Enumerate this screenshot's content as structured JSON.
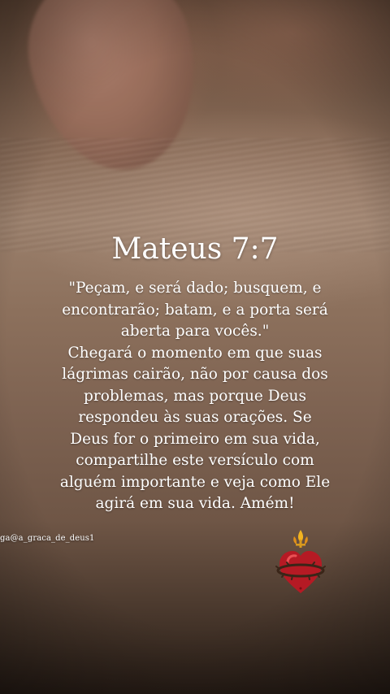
{
  "post": {
    "title": "Mateus 7:7",
    "quote": "\"Peçam, e será dado; busquem, e encontrarão; batam, e a porta será aberta para vocês.\"",
    "message": "Chegará o momento em que suas lágrimas cairão, não por causa dos problemas, mas porque Deus respondeu às suas orações. Se Deus for o primeiro em sua vida, compartilhe este versículo com alguém importante e veja como Ele agirá em sua vida. Amém!",
    "handle": "ga@a_graca_de_deus1"
  },
  "decoration": {
    "icon": "sacred-heart-icon",
    "heart_color": "#b51a24",
    "crown_color": "#e8a21c"
  }
}
